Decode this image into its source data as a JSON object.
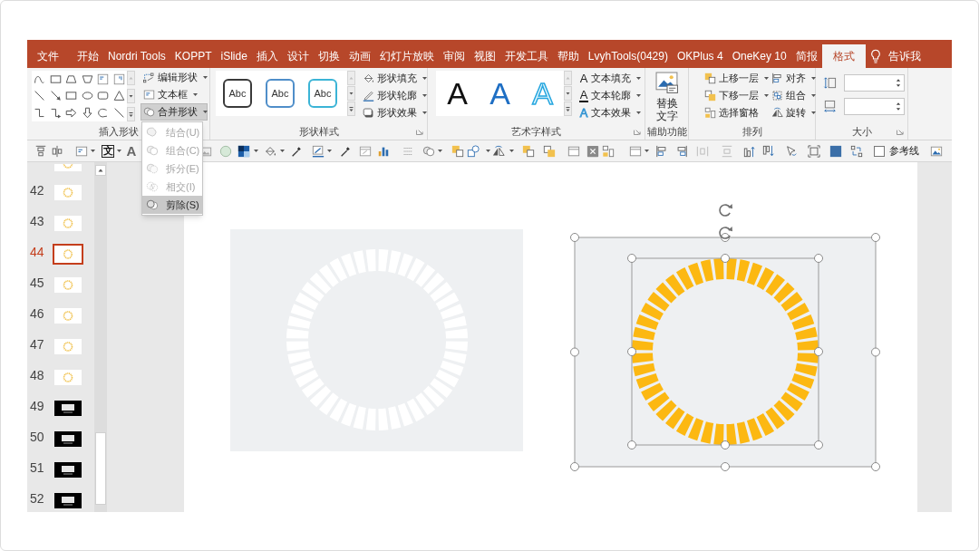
{
  "menu_bar": {
    "tabs": [
      {
        "label": "文件",
        "selected": false
      },
      {
        "label": "开始",
        "selected": false
      },
      {
        "label": "Nordri Tools",
        "selected": false
      },
      {
        "label": "KOPPT",
        "selected": false
      },
      {
        "label": "iSlide",
        "selected": false
      },
      {
        "label": "插入",
        "selected": false
      },
      {
        "label": "设计",
        "selected": false
      },
      {
        "label": "切换",
        "selected": false
      },
      {
        "label": "动画",
        "selected": false
      },
      {
        "label": "幻灯片放映",
        "selected": false
      },
      {
        "label": "审阅",
        "selected": false
      },
      {
        "label": "视图",
        "selected": false
      },
      {
        "label": "开发工具",
        "selected": false
      },
      {
        "label": "帮助",
        "selected": false
      },
      {
        "label": "LvyhTools(0429)",
        "selected": false
      },
      {
        "label": "OKPlus 4",
        "selected": false
      },
      {
        "label": "OneKey 10",
        "selected": false
      },
      {
        "label": "简报",
        "selected": false
      },
      {
        "label": "格式",
        "selected": true
      }
    ],
    "tell_me": "告诉我"
  },
  "ribbon": {
    "groups": [
      {
        "kind": "insert_shapes",
        "label": "插入形状",
        "buttons": [
          {
            "label": "编辑形状",
            "pressed": false,
            "dropdown": true
          },
          {
            "label": "文本框",
            "pressed": false,
            "dropdown": true
          },
          {
            "label": "合并形状",
            "pressed": true,
            "dropdown": true
          }
        ]
      },
      {
        "kind": "shape_styles",
        "label": "形状样式",
        "samples": [
          "Abc",
          "Abc",
          "Abc"
        ],
        "buttons": [
          {
            "label": "形状填充",
            "dropdown": true
          },
          {
            "label": "形状轮廓",
            "dropdown": true
          },
          {
            "label": "形状效果",
            "dropdown": true
          }
        ]
      },
      {
        "kind": "wordart_styles",
        "label": "艺术字样式",
        "samples": [
          "A",
          "A",
          "A"
        ],
        "buttons": [
          {
            "label": "文本填充",
            "glyph": "A",
            "dropdown": true
          },
          {
            "label": "文本轮廓",
            "glyph": "A",
            "dropdown": true
          },
          {
            "label": "文本效果",
            "glyph": "A",
            "dropdown": true
          }
        ]
      },
      {
        "kind": "accessibility",
        "label": "辅助功能",
        "buttons": [
          {
            "label": "替换文字",
            "dropdown": false
          }
        ]
      },
      {
        "kind": "arrange",
        "label": "排列",
        "buttons": [
          {
            "label": "上移一层",
            "dropdown": true
          },
          {
            "label": "下移一层",
            "dropdown": true
          },
          {
            "label": "选择窗格",
            "dropdown": false
          },
          {
            "label": "对齐",
            "dropdown": true
          },
          {
            "label": "组合",
            "dropdown": true
          },
          {
            "label": "旋转",
            "dropdown": true
          }
        ]
      },
      {
        "kind": "size",
        "label": "大小"
      }
    ]
  },
  "merge_menu": {
    "items": [
      {
        "label": "结合(U)",
        "disabled": true,
        "selected": false
      },
      {
        "label": "组合(C)",
        "disabled": true,
        "selected": false
      },
      {
        "label": "拆分(E)",
        "disabled": true,
        "selected": false
      },
      {
        "label": "相交(I)",
        "disabled": true,
        "selected": false
      },
      {
        "label": "剪除(S)",
        "disabled": false,
        "selected": true
      }
    ]
  },
  "quick_toolbar": {
    "glyphs": [
      "文",
      "A"
    ],
    "guides": {
      "label": "参考线",
      "checked": false
    }
  },
  "slide_panel": {
    "slides": [
      {
        "kind": "light",
        "selected": false
      },
      {
        "number": "42",
        "kind": "light",
        "selected": false
      },
      {
        "number": "43",
        "kind": "light",
        "selected": false
      },
      {
        "number": "44",
        "kind": "light",
        "selected": true
      },
      {
        "number": "45",
        "kind": "light",
        "selected": false
      },
      {
        "number": "46",
        "kind": "light",
        "selected": false
      },
      {
        "number": "47",
        "kind": "light",
        "selected": false
      },
      {
        "number": "48",
        "kind": "light",
        "selected": false
      },
      {
        "number": "49",
        "kind": "dark",
        "selected": false
      },
      {
        "number": "50",
        "kind": "dark",
        "selected": false
      },
      {
        "number": "51",
        "kind": "dark",
        "selected": false
      },
      {
        "number": "52",
        "kind": "dark",
        "selected": false
      }
    ]
  },
  "slide": {
    "shapes": [
      {
        "kind": "segmented_ring",
        "color": "#ffffff",
        "selected": false
      },
      {
        "kind": "segmented_ring",
        "color": "#fcb812",
        "selected": true
      }
    ]
  }
}
